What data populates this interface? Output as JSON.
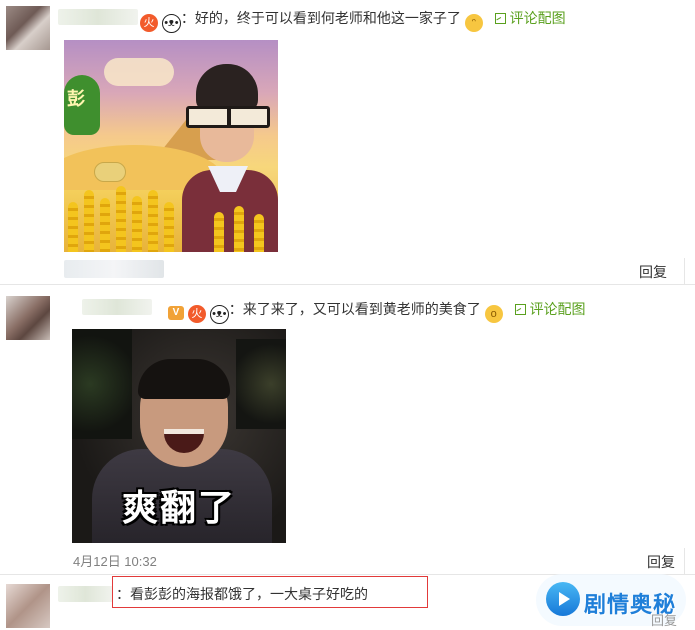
{
  "comments": [
    {
      "text": "：好的，终于可以看到何老师和他这一家子了",
      "emojis": [
        "fire-badge",
        "panda",
        "smile"
      ],
      "pic_link": "评论配图",
      "reply": "回复"
    },
    {
      "text": "：来了来了，又可以看到黄老师的美食了",
      "badges": [
        "V",
        "fire-badge",
        "panda",
        "shock"
      ],
      "vip_label": "V",
      "pic_link": "评论配图",
      "image_caption": "爽翻了",
      "timestamp": "4月12日 10:32",
      "reply": "回复"
    },
    {
      "text": "：看彭彭的海报都饿了，一大桌子好吃的",
      "reply": "回复"
    }
  ],
  "image1": {
    "tree_text": "彭"
  },
  "watermark": {
    "text": "剧情奥秘"
  },
  "colors": {
    "link_green": "#5aa01e",
    "highlight_red": "#e23a3a",
    "watermark_blue": "#1f7fd9"
  }
}
